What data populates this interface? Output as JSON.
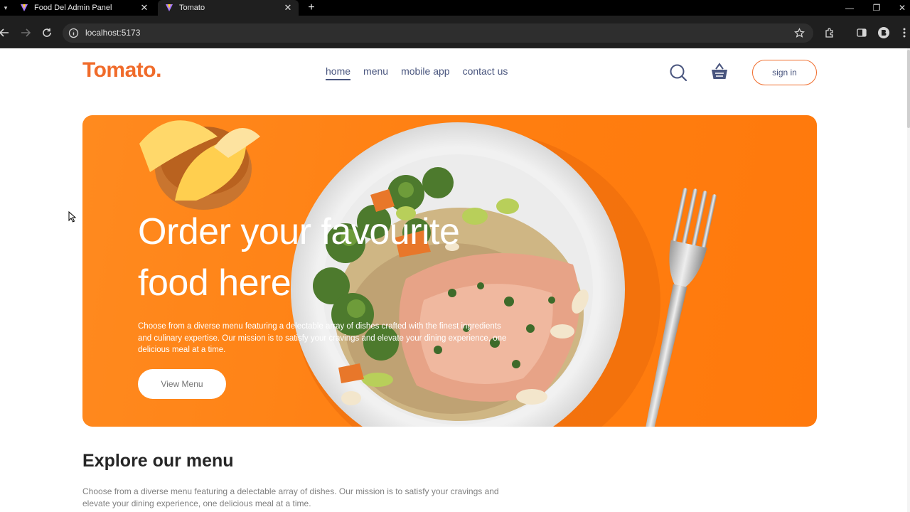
{
  "browser": {
    "tabs": [
      {
        "title": "Food Del Admin Panel",
        "active": false
      },
      {
        "title": "Tomato",
        "active": true
      }
    ],
    "url": "localhost:5173",
    "icons": {
      "back": "back-arrow-icon",
      "forward": "forward-arrow-icon",
      "reload": "reload-icon",
      "info": "site-info-icon",
      "bookmark": "star-icon",
      "extensions": "extensions-icon",
      "sidepanel": "side-panel-icon",
      "profile": "profile-icon",
      "menu": "kebab-menu-icon"
    }
  },
  "header": {
    "logo": "Tomato.",
    "nav": [
      "home",
      "menu",
      "mobile app",
      "contact us"
    ],
    "active_nav": "home",
    "sign_in": "sign in"
  },
  "hero": {
    "title": "Order your favourite food here",
    "description": "Choose from a diverse menu featuring a delectable array of dishes crafted with the finest ingredients and culinary expertise. Our mission is to satisfy your cravings and elevate your dining experience, one delicious meal at a time.",
    "button": "View Menu"
  },
  "explore": {
    "title": "Explore our menu",
    "description": "Choose from a diverse menu featuring a delectable array of dishes. Our mission is to satisfy your cravings and elevate your dining experience, one delicious meal at a time."
  },
  "colors": {
    "brand": "#f06b2a",
    "hero_bg": "#ff7e10",
    "nav_text": "#49557e",
    "browser_dark": "#1f1f1f"
  }
}
